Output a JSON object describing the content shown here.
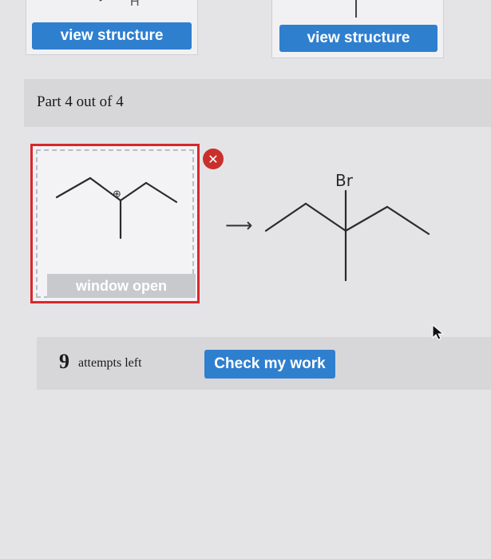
{
  "structures": {
    "left": {
      "button_label": "view structure",
      "partial_atom": "H"
    },
    "right": {
      "button_label": "view structure"
    }
  },
  "part": {
    "title": "Part 4 out of 4"
  },
  "drawing": {
    "window_label": "window open",
    "close_icon": "close-icon",
    "charge_symbol": "⊕",
    "border_color": "#d8282c"
  },
  "reaction": {
    "arrow": "⟶"
  },
  "product": {
    "substituent": "Br"
  },
  "attempts": {
    "count": "9",
    "label": "attempts left"
  },
  "actions": {
    "check_label": "Check my work"
  },
  "colors": {
    "accent": "#2f7fcf",
    "error": "#c9302c"
  }
}
